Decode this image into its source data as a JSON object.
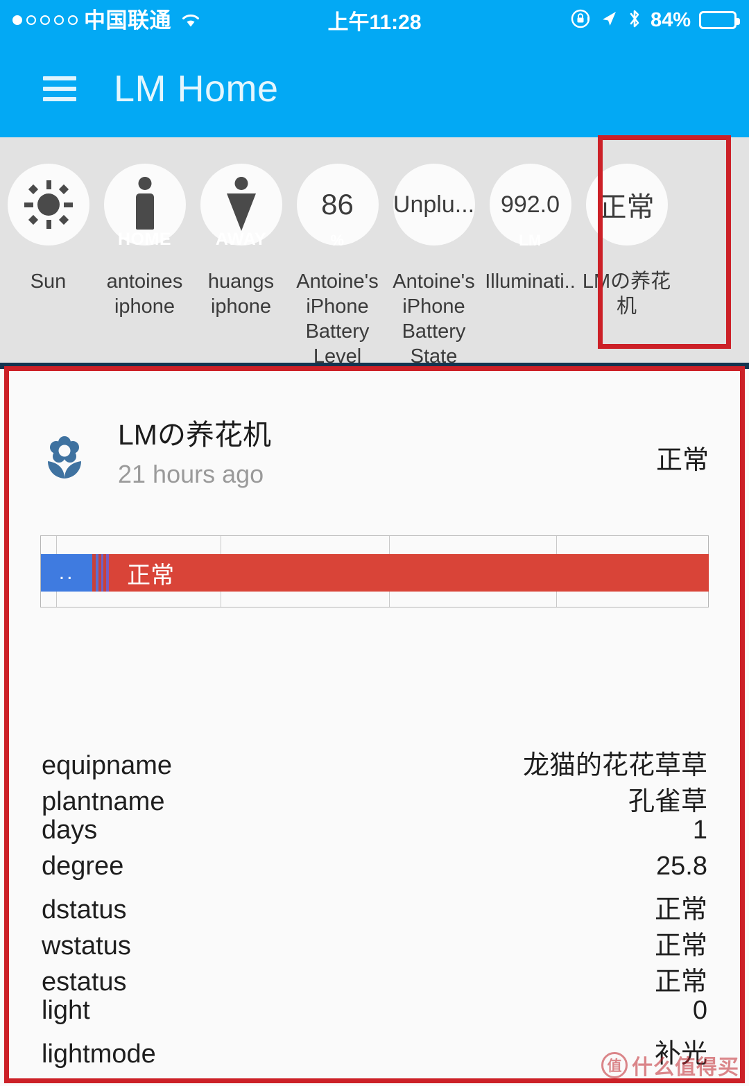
{
  "statusbar": {
    "carrier": "中国联通",
    "time": "上午11:28",
    "battery_percent": "84%",
    "signal_dots_total": 5,
    "signal_dots_filled": 1,
    "icons": [
      "wifi-icon",
      "rotation-lock-icon",
      "location-arrow-icon",
      "bluetooth-icon",
      "battery-icon"
    ]
  },
  "appbar": {
    "menu_icon": "hamburger-menu-icon",
    "title": "LM Home",
    "background": "#03a9f4"
  },
  "badges": [
    {
      "icon": "sun-icon",
      "value": "",
      "unit": "",
      "label": "Sun"
    },
    {
      "icon": "person-male-icon",
      "value": "",
      "unit": "HOME",
      "label": "antoines\niphone"
    },
    {
      "icon": "person-female-icon",
      "value": "",
      "unit": "AWAY",
      "label": "huangs\niphone"
    },
    {
      "icon": "",
      "value": "86",
      "unit": "%",
      "label": "Antoine's\niPhone\nBattery\nLevel"
    },
    {
      "icon": "",
      "value": "Unplu...",
      "unit": "",
      "label": "Antoine's\niPhone\nBattery\nState"
    },
    {
      "icon": "",
      "value": "992.0",
      "unit": "LM",
      "label": "Illuminati.."
    },
    {
      "icon": "",
      "value": "正常",
      "unit": "",
      "label": "LMの养花\n机"
    }
  ],
  "card": {
    "icon": "flower-icon",
    "title": "LMの养花机",
    "subtitle": "21 hours ago",
    "state": "正常"
  },
  "timeline": {
    "segments": [
      {
        "label": "..",
        "color": "#3f7be0",
        "width_pct": 7.7
      },
      {
        "label": "",
        "color": "#c8413a",
        "width_pct": 0.5
      },
      {
        "label": "",
        "color": "#5b6fd0",
        "width_pct": 0.4
      },
      {
        "label": "",
        "color": "#c8413a",
        "width_pct": 0.4
      },
      {
        "label": "",
        "color": "#6b63c8",
        "width_pct": 0.4
      },
      {
        "label": "",
        "color": "#c8413a",
        "width_pct": 0.4
      },
      {
        "label": "",
        "color": "#7a5cc0",
        "width_pct": 0.4
      },
      {
        "label": "正常",
        "color": "#d94438",
        "width_pct": 89.8
      }
    ],
    "gridlines_pct": [
      2.3,
      26.9,
      52.2,
      77.2
    ]
  },
  "attributes": [
    {
      "key": "equipname",
      "value": "龙猫的花花草草"
    },
    {
      "key": "plantname",
      "value": "孔雀草"
    },
    {
      "key": "days",
      "value": "1"
    },
    {
      "key": "degree",
      "value": "25.8"
    },
    {
      "key": "dstatus",
      "value": "正常"
    },
    {
      "key": "wstatus",
      "value": "正常"
    },
    {
      "key": "estatus",
      "value": "正常"
    },
    {
      "key": "light",
      "value": "0"
    },
    {
      "key": "lightmode",
      "value": "补光"
    }
  ],
  "annotations": {
    "color": "#cc2027",
    "badge_box_name": "highlight-box-badge",
    "card_box_name": "highlight-box-card"
  },
  "watermark": {
    "logo_char": "值",
    "text": "什么值得买"
  }
}
